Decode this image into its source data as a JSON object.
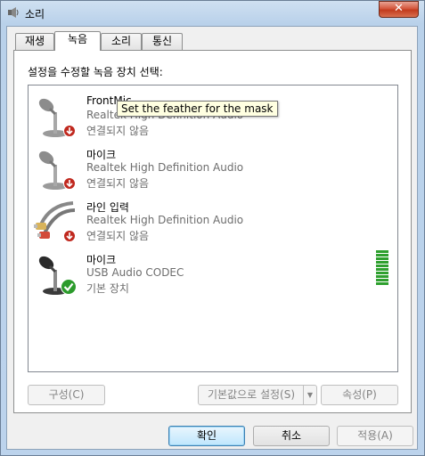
{
  "window": {
    "title": "소리",
    "close_glyph": "✕"
  },
  "tabs": [
    {
      "label": "재생"
    },
    {
      "label": "녹음"
    },
    {
      "label": "소리"
    },
    {
      "label": "통신"
    }
  ],
  "panel": {
    "instruction": "설정을 수정할 녹음 장치 선택:"
  },
  "devices": [
    {
      "name": "FrontMic",
      "description": "Realtek High Definition Audio",
      "status": "연결되지 않음",
      "icon": "microphone-icon",
      "badge": "disconnected-badge-icon"
    },
    {
      "name": "마이크",
      "description": "Realtek High Definition Audio",
      "status": "연결되지 않음",
      "icon": "microphone-icon",
      "badge": "disconnected-badge-icon"
    },
    {
      "name": "라인 입력",
      "description": "Realtek High Definition Audio",
      "status": "연결되지 않음",
      "icon": "line-in-cable-icon",
      "badge": "disconnected-badge-icon"
    },
    {
      "name": "마이크",
      "description": "USB Audio CODEC",
      "status": "기본 장치",
      "icon": "microphone-icon",
      "badge": "default-check-icon",
      "level_fraction": 1.0
    }
  ],
  "tooltip": {
    "text": "Set the feather for the mask"
  },
  "buttons": {
    "configure": "구성(C)",
    "set_default": "기본값으로 설정(S)",
    "properties": "속성(P)",
    "ok": "확인",
    "cancel": "취소",
    "apply": "적용(A)"
  },
  "colors": {
    "level_meter": "#2ea02e",
    "disconnected_badge": "#c0281e",
    "default_badge": "#2c9b2c"
  }
}
